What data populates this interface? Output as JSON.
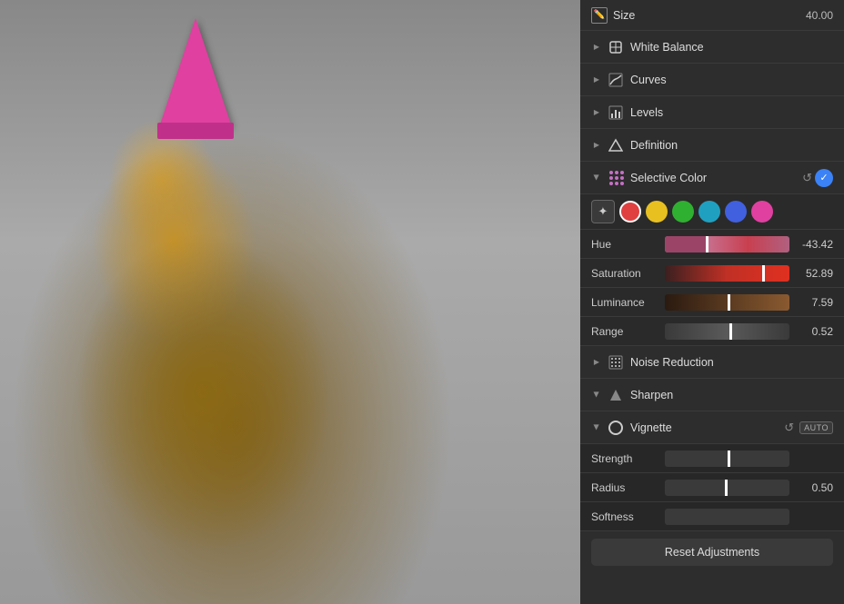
{
  "photo": {
    "alt": "Dog wearing party hat"
  },
  "panels": {
    "size": {
      "label": "Size",
      "value": "40.00"
    },
    "white_balance": {
      "label": "White Balance"
    },
    "curves": {
      "label": "Curves"
    },
    "levels": {
      "label": "Levels"
    },
    "definition": {
      "label": "Definition"
    },
    "selective_color": {
      "label": "Selective Color",
      "swatches": [
        {
          "color": "#e04040",
          "label": "red"
        },
        {
          "color": "#e8c020",
          "label": "yellow"
        },
        {
          "color": "#30b030",
          "label": "green"
        },
        {
          "color": "#20a0c0",
          "label": "cyan"
        },
        {
          "color": "#4060e0",
          "label": "blue"
        },
        {
          "color": "#e040a0",
          "label": "magenta"
        }
      ],
      "hue": {
        "label": "Hue",
        "value": "-43.42"
      },
      "saturation": {
        "label": "Saturation",
        "value": "52.89"
      },
      "luminance": {
        "label": "Luminance",
        "value": "7.59"
      },
      "range": {
        "label": "Range",
        "value": "0.52"
      }
    },
    "noise_reduction": {
      "label": "Noise Reduction"
    },
    "sharpen": {
      "label": "Sharpen"
    },
    "vignette": {
      "label": "Vignette",
      "auto_label": "AUTO",
      "strength": {
        "label": "Strength",
        "value": ""
      },
      "radius": {
        "label": "Radius",
        "value": "0.50"
      },
      "softness": {
        "label": "Softness",
        "value": ""
      }
    },
    "reset_button": {
      "label": "Reset Adjustments"
    }
  }
}
